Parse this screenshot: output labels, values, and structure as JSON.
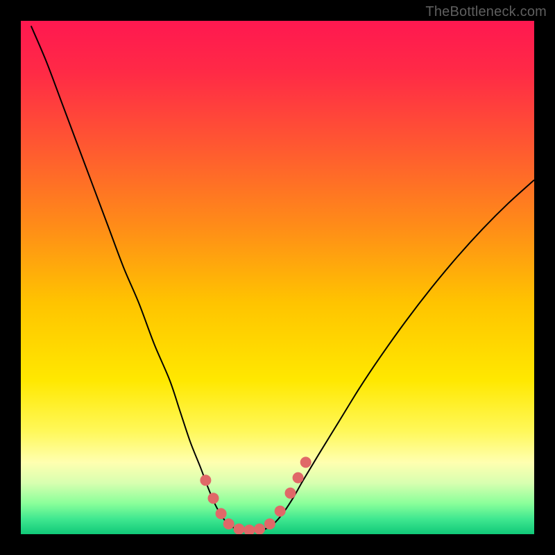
{
  "watermark": "TheBottleneck.com",
  "chart_data": {
    "type": "line",
    "title": "",
    "xlabel": "",
    "ylabel": "",
    "xlim": [
      0,
      100
    ],
    "ylim": [
      0,
      100
    ],
    "background_gradient": {
      "stops": [
        {
          "offset": 0.0,
          "color": "#ff1850"
        },
        {
          "offset": 0.1,
          "color": "#ff2a46"
        },
        {
          "offset": 0.25,
          "color": "#ff5a30"
        },
        {
          "offset": 0.4,
          "color": "#ff8c18"
        },
        {
          "offset": 0.55,
          "color": "#ffc400"
        },
        {
          "offset": 0.7,
          "color": "#ffe800"
        },
        {
          "offset": 0.8,
          "color": "#fff85a"
        },
        {
          "offset": 0.86,
          "color": "#ffffb0"
        },
        {
          "offset": 0.9,
          "color": "#d8ffb0"
        },
        {
          "offset": 0.94,
          "color": "#8aff9a"
        },
        {
          "offset": 0.97,
          "color": "#40e890"
        },
        {
          "offset": 1.0,
          "color": "#10c878"
        }
      ]
    },
    "series": [
      {
        "name": "bottleneck-curve",
        "stroke": "#000000",
        "stroke_width": 2,
        "points": [
          {
            "x": 2.0,
            "y": 99.0
          },
          {
            "x": 5.0,
            "y": 92.0
          },
          {
            "x": 8.0,
            "y": 84.0
          },
          {
            "x": 11.0,
            "y": 76.0
          },
          {
            "x": 14.0,
            "y": 68.0
          },
          {
            "x": 17.0,
            "y": 60.0
          },
          {
            "x": 20.0,
            "y": 52.0
          },
          {
            "x": 23.0,
            "y": 45.0
          },
          {
            "x": 26.0,
            "y": 37.0
          },
          {
            "x": 29.0,
            "y": 30.0
          },
          {
            "x": 31.0,
            "y": 24.0
          },
          {
            "x": 33.0,
            "y": 18.0
          },
          {
            "x": 35.0,
            "y": 13.0
          },
          {
            "x": 36.5,
            "y": 9.0
          },
          {
            "x": 38.0,
            "y": 5.5
          },
          {
            "x": 39.5,
            "y": 3.0
          },
          {
            "x": 41.0,
            "y": 1.5
          },
          {
            "x": 43.0,
            "y": 0.8
          },
          {
            "x": 45.0,
            "y": 0.6
          },
          {
            "x": 47.0,
            "y": 0.8
          },
          {
            "x": 49.0,
            "y": 1.8
          },
          {
            "x": 51.0,
            "y": 4.0
          },
          {
            "x": 53.0,
            "y": 7.0
          },
          {
            "x": 55.0,
            "y": 10.5
          },
          {
            "x": 58.0,
            "y": 15.5
          },
          {
            "x": 62.0,
            "y": 22.0
          },
          {
            "x": 66.0,
            "y": 28.5
          },
          {
            "x": 70.0,
            "y": 34.5
          },
          {
            "x": 75.0,
            "y": 41.5
          },
          {
            "x": 80.0,
            "y": 48.0
          },
          {
            "x": 85.0,
            "y": 54.0
          },
          {
            "x": 90.0,
            "y": 59.5
          },
          {
            "x": 95.0,
            "y": 64.5
          },
          {
            "x": 100.0,
            "y": 69.0
          }
        ]
      }
    ],
    "markers": {
      "color": "#e06868",
      "radius": 8,
      "points": [
        {
          "x": 36.0,
          "y": 10.5
        },
        {
          "x": 37.5,
          "y": 7.0
        },
        {
          "x": 39.0,
          "y": 4.0
        },
        {
          "x": 40.5,
          "y": 2.0
        },
        {
          "x": 42.5,
          "y": 1.0
        },
        {
          "x": 44.5,
          "y": 0.8
        },
        {
          "x": 46.5,
          "y": 1.0
        },
        {
          "x": 48.5,
          "y": 2.0
        },
        {
          "x": 50.5,
          "y": 4.5
        },
        {
          "x": 52.5,
          "y": 8.0
        },
        {
          "x": 54.0,
          "y": 11.0
        },
        {
          "x": 55.5,
          "y": 14.0
        }
      ]
    }
  }
}
